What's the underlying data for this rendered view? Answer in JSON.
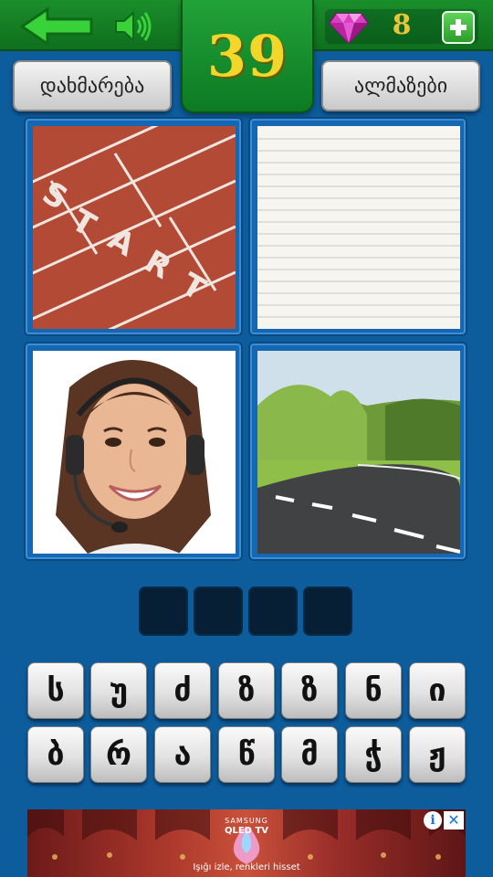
{
  "header": {
    "level": "39",
    "gems": "8",
    "icons": {
      "back": "back-arrow-icon",
      "sound": "speaker-icon",
      "gem": "gem-icon",
      "plus": "plus-icon"
    },
    "accent_color": "#1a8e2b",
    "level_color": "#f2d62a"
  },
  "buttons": {
    "help_label": "დახმარება",
    "gems_label": "ალმაზები"
  },
  "pictures": [
    {
      "subject": "running-track-start"
    },
    {
      "subject": "lined-paper"
    },
    {
      "subject": "call-center-operator"
    },
    {
      "subject": "road-through-hills"
    }
  ],
  "answer": {
    "slots": [
      "",
      "",
      "",
      ""
    ]
  },
  "keyboard": {
    "rows": [
      [
        "ს",
        "უ",
        "ძ",
        "ზ",
        "ზ",
        "ნ",
        "ი"
      ],
      [
        "ბ",
        "რ",
        "ა",
        "წ",
        "მ",
        "ჭ",
        "ჟ"
      ]
    ]
  },
  "ad": {
    "brand": "SAMSUNG",
    "product": "QLED TV",
    "tagline": "Işığı izle, renkleri hisset"
  }
}
